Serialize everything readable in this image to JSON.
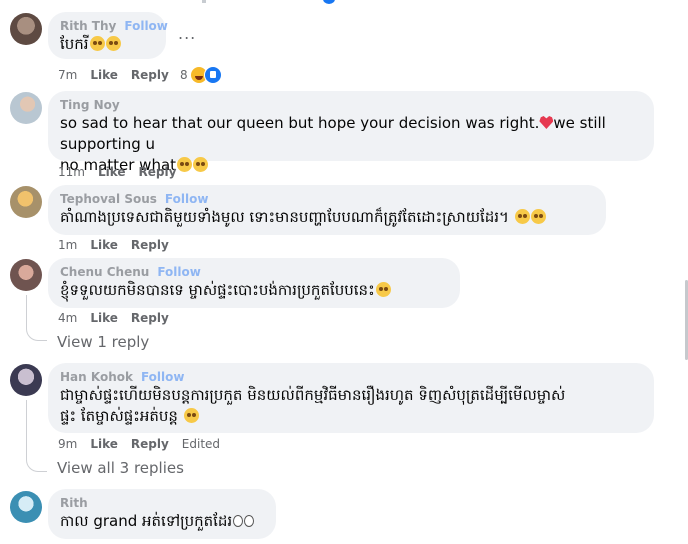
{
  "comments": [
    {
      "author": "Rith Thy",
      "follow": "Follow",
      "text": "បែករី",
      "time": "7m",
      "like": "Like",
      "reply": "Reply",
      "reaction_count": "8"
    },
    {
      "author": "Ting Noy",
      "text_line1": "so sad to hear that our queen but hope your decision was right.",
      "text_line1b": "we still supporting u",
      "text_line2": "no matter what",
      "time": "11m",
      "like": "Like",
      "reply": "Reply"
    },
    {
      "author": "Tephoval Sous",
      "follow": "Follow",
      "text": "គាំណាងប្រទេសជាតិមួយទាំងមូល ទោះមានបញ្ហាបែបណាក៏ត្រូវតែដោះស្រាយដែរ។",
      "time": "1m",
      "like": "Like",
      "reply": "Reply"
    },
    {
      "author": "Chenu Chenu",
      "follow": "Follow",
      "text": "ខ្ញុំទទួលយកមិនបានទេ ម្ចាស់ផ្ទះបោះបង់ការប្រកួតបែបនេះ",
      "time": "4m",
      "like": "Like",
      "reply": "Reply",
      "view_replies": "View 1 reply"
    },
    {
      "author": "Han Kohok",
      "follow": "Follow",
      "text_line1": "ជាម្ចាស់ផ្ទះហើយមិនបន្តការប្រកួត មិនយល់ពីកម្មវិធីមានរឿងរហូត ទិញសំបុត្រដើម្បីមើលម្ចាស់",
      "text_line2": "ផ្ទះ តែម្ចាស់ផ្ទះអត់បន្ត",
      "time": "9m",
      "like": "Like",
      "reply": "Reply",
      "edited": "Edited",
      "view_replies": "View all 3 replies"
    },
    {
      "author": "Rith",
      "text": "កាល grand អត់ទៅប្រកួតដែរ"
    }
  ],
  "more_label": "..."
}
